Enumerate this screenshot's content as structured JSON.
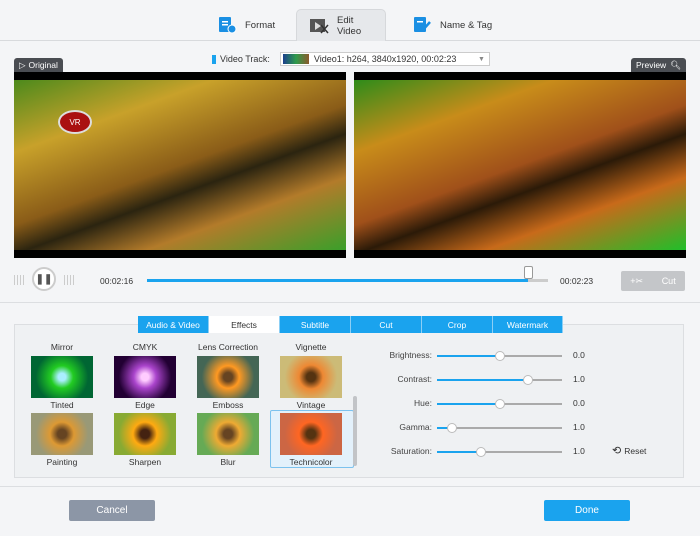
{
  "tabs": [
    {
      "label": "Format"
    },
    {
      "label": "Edit Video",
      "active": true
    },
    {
      "label": "Name & Tag"
    }
  ],
  "video_track": {
    "label": "Video Track:",
    "value": "Video1: h264, 3840x1920, 00:02:23"
  },
  "original_label": "Original",
  "preview_label": "Preview",
  "player": {
    "current_time": "00:02:16",
    "total_time": "00:02:23",
    "progress": 0.95,
    "cut_label": "Cut"
  },
  "edit_tabs": [
    {
      "label": "Audio & Video"
    },
    {
      "label": "Effects",
      "active": true
    },
    {
      "label": "Subtitle"
    },
    {
      "label": "Cut"
    },
    {
      "label": "Crop"
    },
    {
      "label": "Watermark"
    }
  ],
  "effects": {
    "top_labels": [
      "Mirror",
      "CMYK",
      "Lens Correction",
      "Vignette"
    ],
    "row1": [
      "Tinted",
      "Edge",
      "Emboss",
      "Vintage"
    ],
    "row2": [
      "Painting",
      "Sharpen",
      "Blur",
      "Technicolor"
    ],
    "selected": "Technicolor"
  },
  "adjust": [
    {
      "label": "Brightness:",
      "value": "0.0",
      "level": 0.5
    },
    {
      "label": "Contrast:",
      "value": "1.0",
      "level": 0.73
    },
    {
      "label": "Hue:",
      "value": "0.0",
      "level": 0.5
    },
    {
      "label": "Gamma:",
      "value": "1.0",
      "level": 0.12
    },
    {
      "label": "Saturation:",
      "value": "1.0",
      "level": 0.35
    }
  ],
  "reset_label": "Reset",
  "cancel_label": "Cancel",
  "done_label": "Done",
  "colors": {
    "accent": "#1aa3ee",
    "cancel": "#8c96a6"
  }
}
